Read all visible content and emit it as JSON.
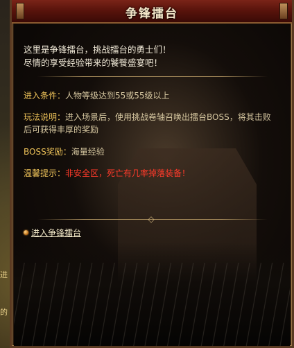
{
  "window": {
    "title": "争锋擂台"
  },
  "intro": [
    "这里是争锋擂台，挑战擂台的勇士们！",
    "尽情的享受经验带来的饕餮盛宴吧！"
  ],
  "info": {
    "condition": {
      "label": "进入条件：",
      "value": "人物等级达到55或55级以上"
    },
    "gameplay": {
      "label": "玩法说明：",
      "value_line1": "进入场景后，使用挑战卷轴召唤出擂台BOSS，将其击败",
      "value_line2": "后可获得丰厚的奖励"
    },
    "reward": {
      "label": "BOSS奖励：",
      "value": "海量经验"
    },
    "warning": {
      "label": "温馨提示：",
      "value": "非安全区，死亡有几率掉落装备！"
    }
  },
  "entry_link": {
    "label": "进入争锋擂台"
  },
  "backdrop": {
    "left_text_1": "进",
    "left_text_2": "的"
  },
  "colors": {
    "title_bar": "#5a140c",
    "label_gold": "#f0c45a",
    "warning_red": "#ff3a2a",
    "body_text": "#d6c7a0"
  }
}
